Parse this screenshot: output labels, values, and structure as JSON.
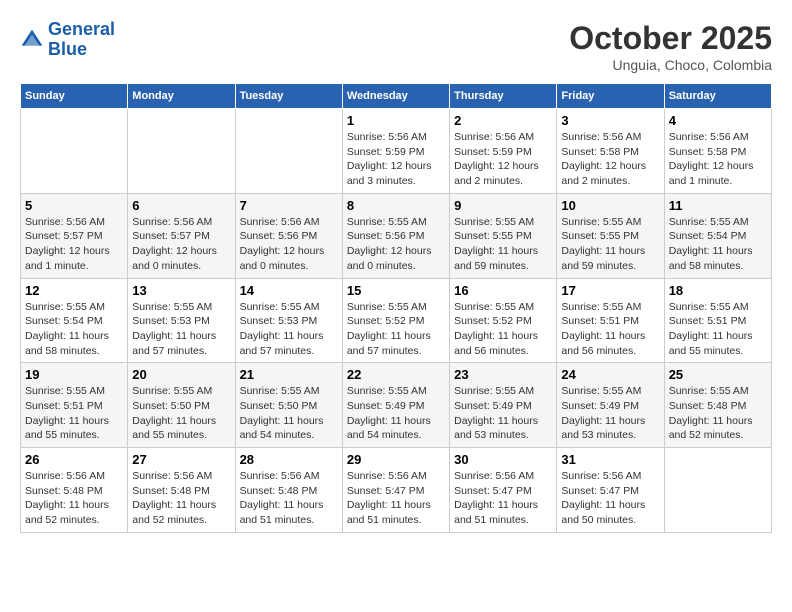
{
  "logo": {
    "line1": "General",
    "line2": "Blue"
  },
  "title": "October 2025",
  "location": "Unguia, Choco, Colombia",
  "weekdays": [
    "Sunday",
    "Monday",
    "Tuesday",
    "Wednesday",
    "Thursday",
    "Friday",
    "Saturday"
  ],
  "weeks": [
    [
      {
        "day": "",
        "info": ""
      },
      {
        "day": "",
        "info": ""
      },
      {
        "day": "",
        "info": ""
      },
      {
        "day": "1",
        "info": "Sunrise: 5:56 AM\nSunset: 5:59 PM\nDaylight: 12 hours\nand 3 minutes."
      },
      {
        "day": "2",
        "info": "Sunrise: 5:56 AM\nSunset: 5:59 PM\nDaylight: 12 hours\nand 2 minutes."
      },
      {
        "day": "3",
        "info": "Sunrise: 5:56 AM\nSunset: 5:58 PM\nDaylight: 12 hours\nand 2 minutes."
      },
      {
        "day": "4",
        "info": "Sunrise: 5:56 AM\nSunset: 5:58 PM\nDaylight: 12 hours\nand 1 minute."
      }
    ],
    [
      {
        "day": "5",
        "info": "Sunrise: 5:56 AM\nSunset: 5:57 PM\nDaylight: 12 hours\nand 1 minute."
      },
      {
        "day": "6",
        "info": "Sunrise: 5:56 AM\nSunset: 5:57 PM\nDaylight: 12 hours\nand 0 minutes."
      },
      {
        "day": "7",
        "info": "Sunrise: 5:56 AM\nSunset: 5:56 PM\nDaylight: 12 hours\nand 0 minutes."
      },
      {
        "day": "8",
        "info": "Sunrise: 5:55 AM\nSunset: 5:56 PM\nDaylight: 12 hours\nand 0 minutes."
      },
      {
        "day": "9",
        "info": "Sunrise: 5:55 AM\nSunset: 5:55 PM\nDaylight: 11 hours\nand 59 minutes."
      },
      {
        "day": "10",
        "info": "Sunrise: 5:55 AM\nSunset: 5:55 PM\nDaylight: 11 hours\nand 59 minutes."
      },
      {
        "day": "11",
        "info": "Sunrise: 5:55 AM\nSunset: 5:54 PM\nDaylight: 11 hours\nand 58 minutes."
      }
    ],
    [
      {
        "day": "12",
        "info": "Sunrise: 5:55 AM\nSunset: 5:54 PM\nDaylight: 11 hours\nand 58 minutes."
      },
      {
        "day": "13",
        "info": "Sunrise: 5:55 AM\nSunset: 5:53 PM\nDaylight: 11 hours\nand 57 minutes."
      },
      {
        "day": "14",
        "info": "Sunrise: 5:55 AM\nSunset: 5:53 PM\nDaylight: 11 hours\nand 57 minutes."
      },
      {
        "day": "15",
        "info": "Sunrise: 5:55 AM\nSunset: 5:52 PM\nDaylight: 11 hours\nand 57 minutes."
      },
      {
        "day": "16",
        "info": "Sunrise: 5:55 AM\nSunset: 5:52 PM\nDaylight: 11 hours\nand 56 minutes."
      },
      {
        "day": "17",
        "info": "Sunrise: 5:55 AM\nSunset: 5:51 PM\nDaylight: 11 hours\nand 56 minutes."
      },
      {
        "day": "18",
        "info": "Sunrise: 5:55 AM\nSunset: 5:51 PM\nDaylight: 11 hours\nand 55 minutes."
      }
    ],
    [
      {
        "day": "19",
        "info": "Sunrise: 5:55 AM\nSunset: 5:51 PM\nDaylight: 11 hours\nand 55 minutes."
      },
      {
        "day": "20",
        "info": "Sunrise: 5:55 AM\nSunset: 5:50 PM\nDaylight: 11 hours\nand 55 minutes."
      },
      {
        "day": "21",
        "info": "Sunrise: 5:55 AM\nSunset: 5:50 PM\nDaylight: 11 hours\nand 54 minutes."
      },
      {
        "day": "22",
        "info": "Sunrise: 5:55 AM\nSunset: 5:49 PM\nDaylight: 11 hours\nand 54 minutes."
      },
      {
        "day": "23",
        "info": "Sunrise: 5:55 AM\nSunset: 5:49 PM\nDaylight: 11 hours\nand 53 minutes."
      },
      {
        "day": "24",
        "info": "Sunrise: 5:55 AM\nSunset: 5:49 PM\nDaylight: 11 hours\nand 53 minutes."
      },
      {
        "day": "25",
        "info": "Sunrise: 5:55 AM\nSunset: 5:48 PM\nDaylight: 11 hours\nand 52 minutes."
      }
    ],
    [
      {
        "day": "26",
        "info": "Sunrise: 5:56 AM\nSunset: 5:48 PM\nDaylight: 11 hours\nand 52 minutes."
      },
      {
        "day": "27",
        "info": "Sunrise: 5:56 AM\nSunset: 5:48 PM\nDaylight: 11 hours\nand 52 minutes."
      },
      {
        "day": "28",
        "info": "Sunrise: 5:56 AM\nSunset: 5:48 PM\nDaylight: 11 hours\nand 51 minutes."
      },
      {
        "day": "29",
        "info": "Sunrise: 5:56 AM\nSunset: 5:47 PM\nDaylight: 11 hours\nand 51 minutes."
      },
      {
        "day": "30",
        "info": "Sunrise: 5:56 AM\nSunset: 5:47 PM\nDaylight: 11 hours\nand 51 minutes."
      },
      {
        "day": "31",
        "info": "Sunrise: 5:56 AM\nSunset: 5:47 PM\nDaylight: 11 hours\nand 50 minutes."
      },
      {
        "day": "",
        "info": ""
      }
    ]
  ]
}
